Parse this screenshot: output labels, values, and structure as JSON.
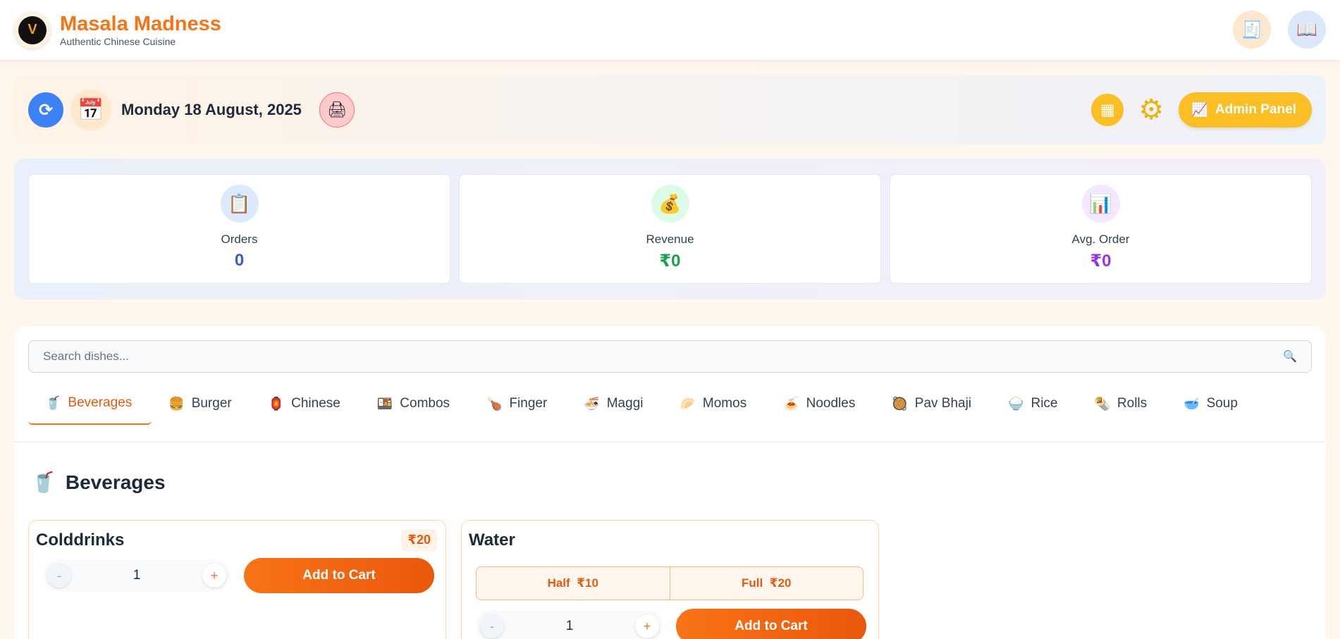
{
  "header": {
    "logo_text": "V",
    "brand_title": "Masala Madness",
    "brand_subtitle": "Authentic Chinese Cuisine",
    "icons": [
      "receipt-icon",
      "menu-book-icon"
    ]
  },
  "toolbar": {
    "date": "Monday 18 August, 2025",
    "admin_label": "Admin Panel"
  },
  "stats": [
    {
      "label": "Orders",
      "value": "0",
      "color": "#3b5bdb"
    },
    {
      "label": "Revenue",
      "value": "₹0",
      "color": "#16a34a"
    },
    {
      "label": "Avg. Order",
      "value": "₹0",
      "color": "#9333ea"
    }
  ],
  "search": {
    "placeholder": "Search dishes..."
  },
  "tabs": [
    {
      "label": "Beverages",
      "icon": "🥤",
      "active": true
    },
    {
      "label": "Burger",
      "icon": "🍔"
    },
    {
      "label": "Chinese",
      "icon": "🏮"
    },
    {
      "label": "Combos",
      "icon": "🍱"
    },
    {
      "label": "Finger",
      "icon": "🍗"
    },
    {
      "label": "Maggi",
      "icon": "🍜"
    },
    {
      "label": "Momos",
      "icon": "🥟"
    },
    {
      "label": "Noodles",
      "icon": "🍝"
    },
    {
      "label": "Pav Bhaji",
      "icon": "🥘"
    },
    {
      "label": "Rice",
      "icon": "🍚"
    },
    {
      "label": "Rolls",
      "icon": "🌯"
    },
    {
      "label": "Soup",
      "icon": "🥣"
    }
  ],
  "section": {
    "title": "Beverages",
    "icon": "🥤"
  },
  "items": [
    {
      "name": "Colddrinks",
      "price": "₹20",
      "qty": "1",
      "minus": "-",
      "plus": "+",
      "add_label": "Add to Cart"
    },
    {
      "name": "Water",
      "variants": [
        {
          "label": "Half",
          "price": "₹10"
        },
        {
          "label": "Full",
          "price": "₹20"
        }
      ],
      "qty": "1",
      "minus": "-",
      "plus": "+",
      "add_label": "Add to Cart"
    }
  ]
}
